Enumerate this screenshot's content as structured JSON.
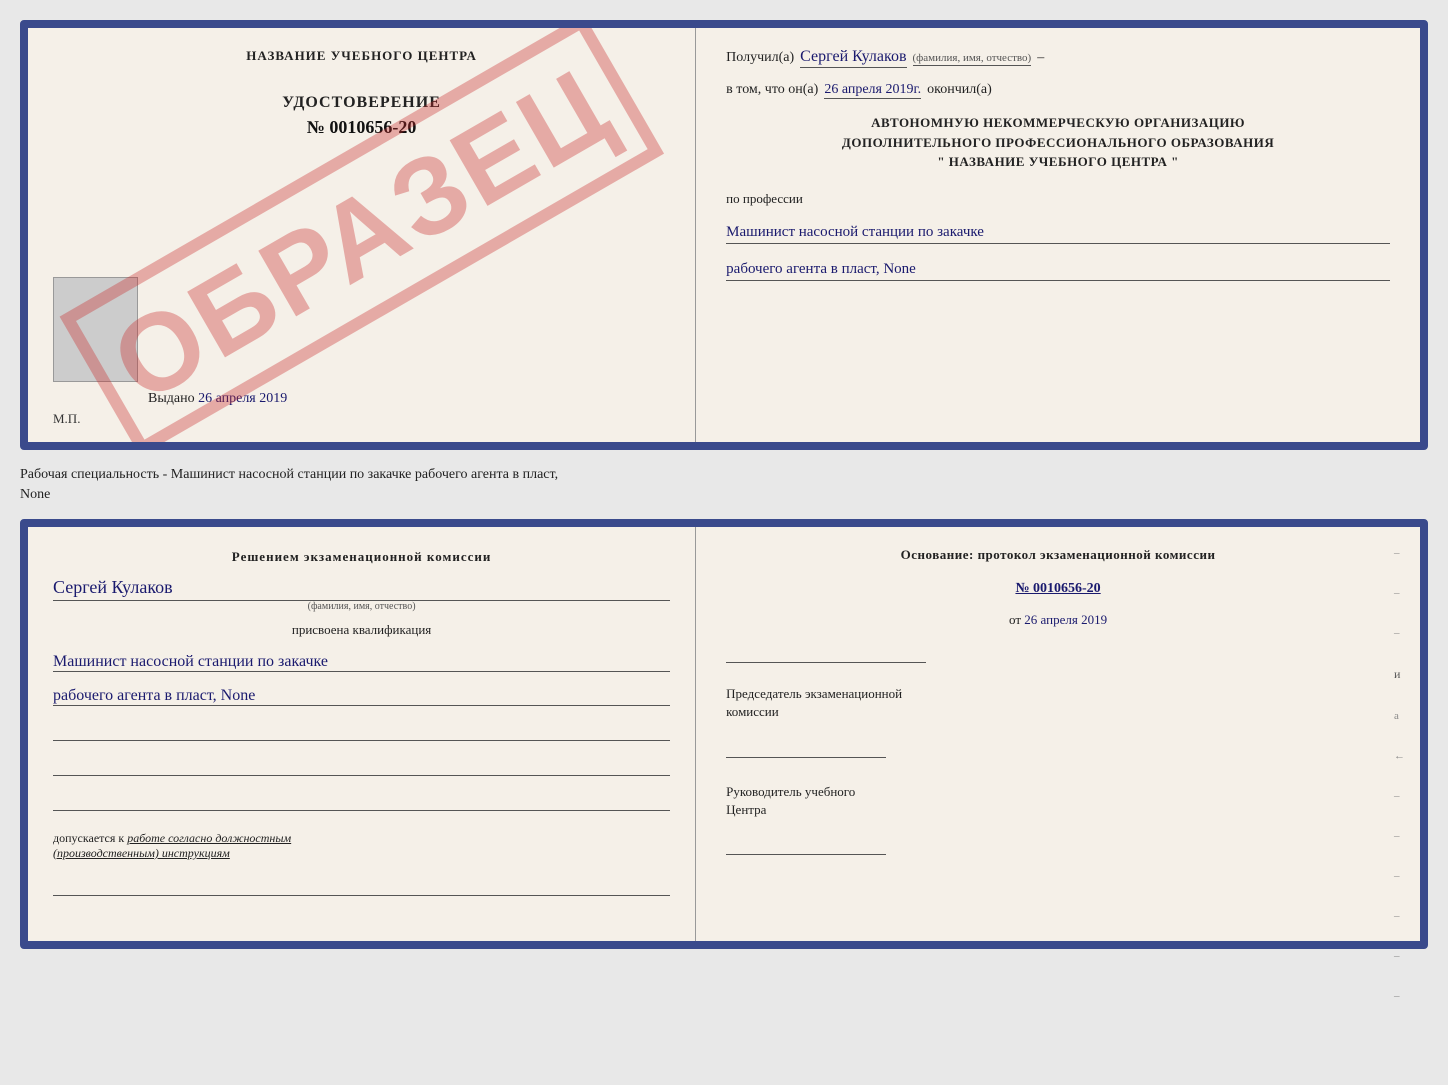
{
  "topCert": {
    "left": {
      "centerTitle": "НАЗВАНИЕ УЧЕБНОГО ЦЕНТРА",
      "watermark": "ОБРАЗЕЦ",
      "udostoverenie": "УДОСТОВЕРЕНИЕ",
      "number": "№ 0010656-20",
      "vydano": "Выдано",
      "vydanoDate": "26 апреля 2019",
      "mp": "М.П."
    },
    "right": {
      "poluchil": "Получил(а)",
      "name": "Сергей Кулаков",
      "nameSubtext": "(фамилия, имя, отчество)",
      "dash": "–",
      "vtom": "в том, что он(а)",
      "date": "26 апреля 2019г.",
      "okonchil": "окончил(а)",
      "orgLine1": "АВТОНОМНУЮ НЕКОММЕРЧЕСКУЮ ОРГАНИЗАЦИЮ",
      "orgLine2": "ДОПОЛНИТЕЛЬНОГО ПРОФЕССИОНАЛЬНОГО ОБРАЗОВАНИЯ",
      "orgLine3": "\"  НАЗВАНИЕ УЧЕБНОГО ЦЕНТРА  \"",
      "poProfessii": "по профессии",
      "profession1": "Машинист насосной станции по закачке",
      "profession2": "рабочего агента в пласт, None"
    }
  },
  "description": {
    "text": "Рабочая специальность - Машинист насосной станции по закачке рабочего агента в пласт,",
    "textLine2": "None"
  },
  "bottomCert": {
    "left": {
      "resheniem": "Решением  экзаменационной  комиссии",
      "name": "Сергей Кулаков",
      "nameSubtext": "(фамилия, имя, отчество)",
      "prisvoena": "присвоена квалификация",
      "qual1": "Машинист насосной станции по закачке",
      "qual2": "рабочего агента в пласт, None",
      "dopuskaetsya1": "допускается к",
      "dopuskaetsya2": "работе согласно должностным",
      "dopuskaetsya3": "(производственным) инструкциям"
    },
    "right": {
      "osnovanie": "Основание: протокол экзаменационной  комиссии",
      "numLabel": "№",
      "num": "0010656-20",
      "ot": "от",
      "date": "26 апреля 2019",
      "predsedatel1": "Председатель экзаменационной",
      "predsedatel2": "комиссии",
      "rukovoditel1": "Руководитель учебного",
      "rukovoditel2": "Центра"
    }
  }
}
